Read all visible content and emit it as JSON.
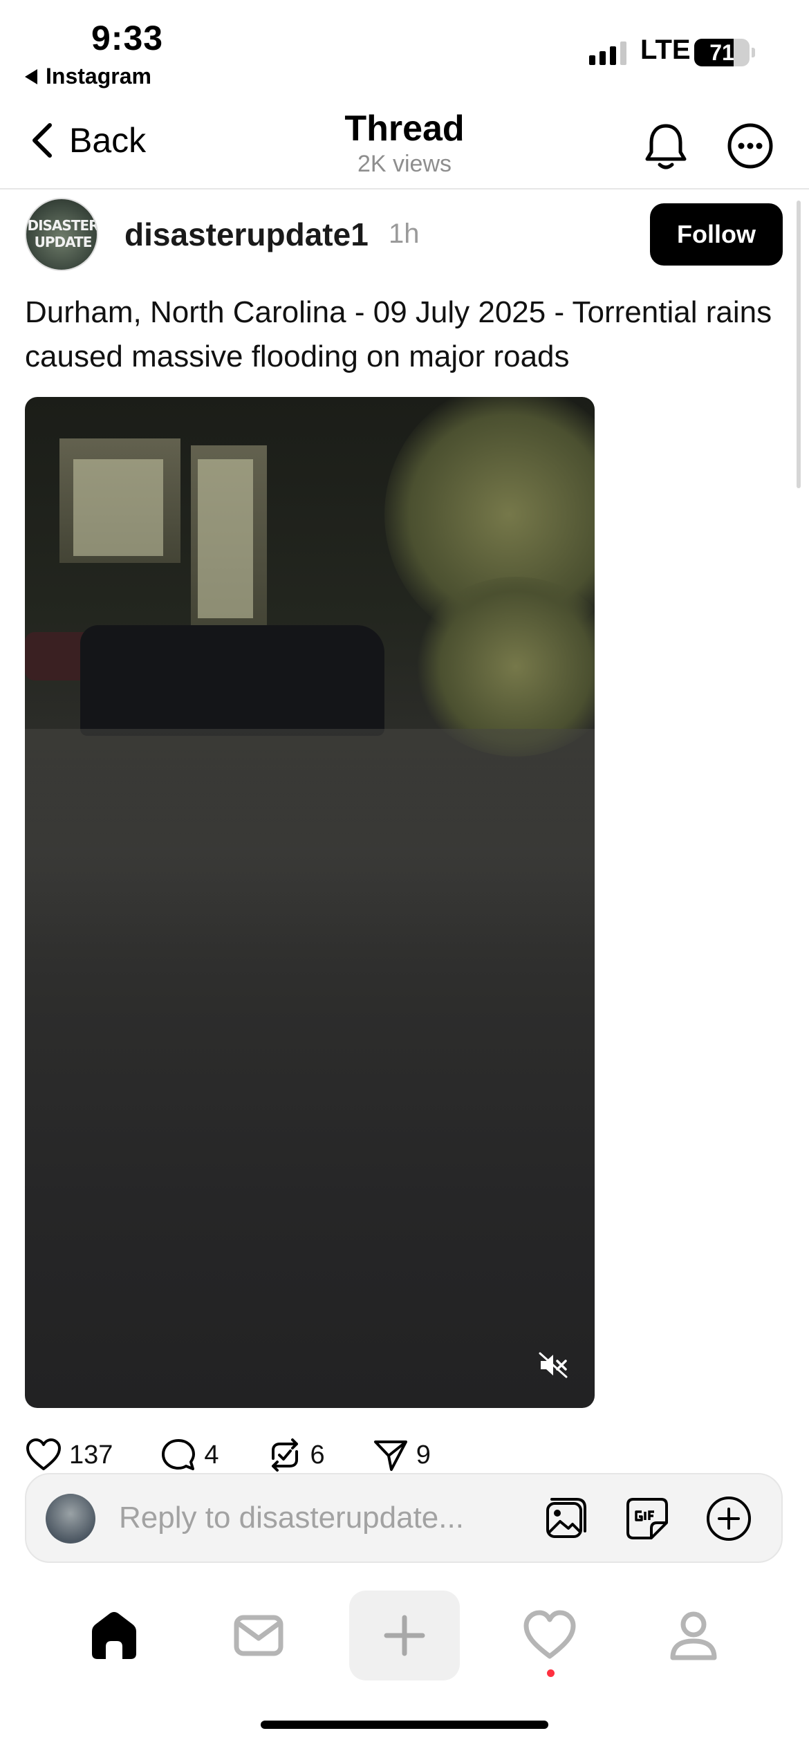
{
  "status_bar": {
    "time": "9:33",
    "back_app": "Instagram",
    "network": "LTE",
    "battery": "71",
    "battery_level": 0.71
  },
  "header": {
    "back_label": "Back",
    "title": "Thread",
    "views": "2K views"
  },
  "post": {
    "avatar_text_line1": "DISASTER",
    "avatar_text_line2": "UPDATE",
    "username": "disasterupdate1",
    "time_ago": "1h",
    "follow_label": "Follow",
    "caption": "Durham, North Carolina - 09 July 2025 - Torrential rains caused massive flooding on major roads",
    "video_muted": true
  },
  "actions": {
    "likes": "137",
    "replies": "4",
    "reposts": "6",
    "shares": "9"
  },
  "reply_bar": {
    "placeholder": "Reply to disasterupdate..."
  },
  "tab_bar": {
    "items": [
      "home-icon",
      "inbox-icon",
      "create-icon",
      "activity-icon",
      "profile-icon"
    ],
    "active": "home-icon",
    "notification_color": "#ff3040"
  }
}
